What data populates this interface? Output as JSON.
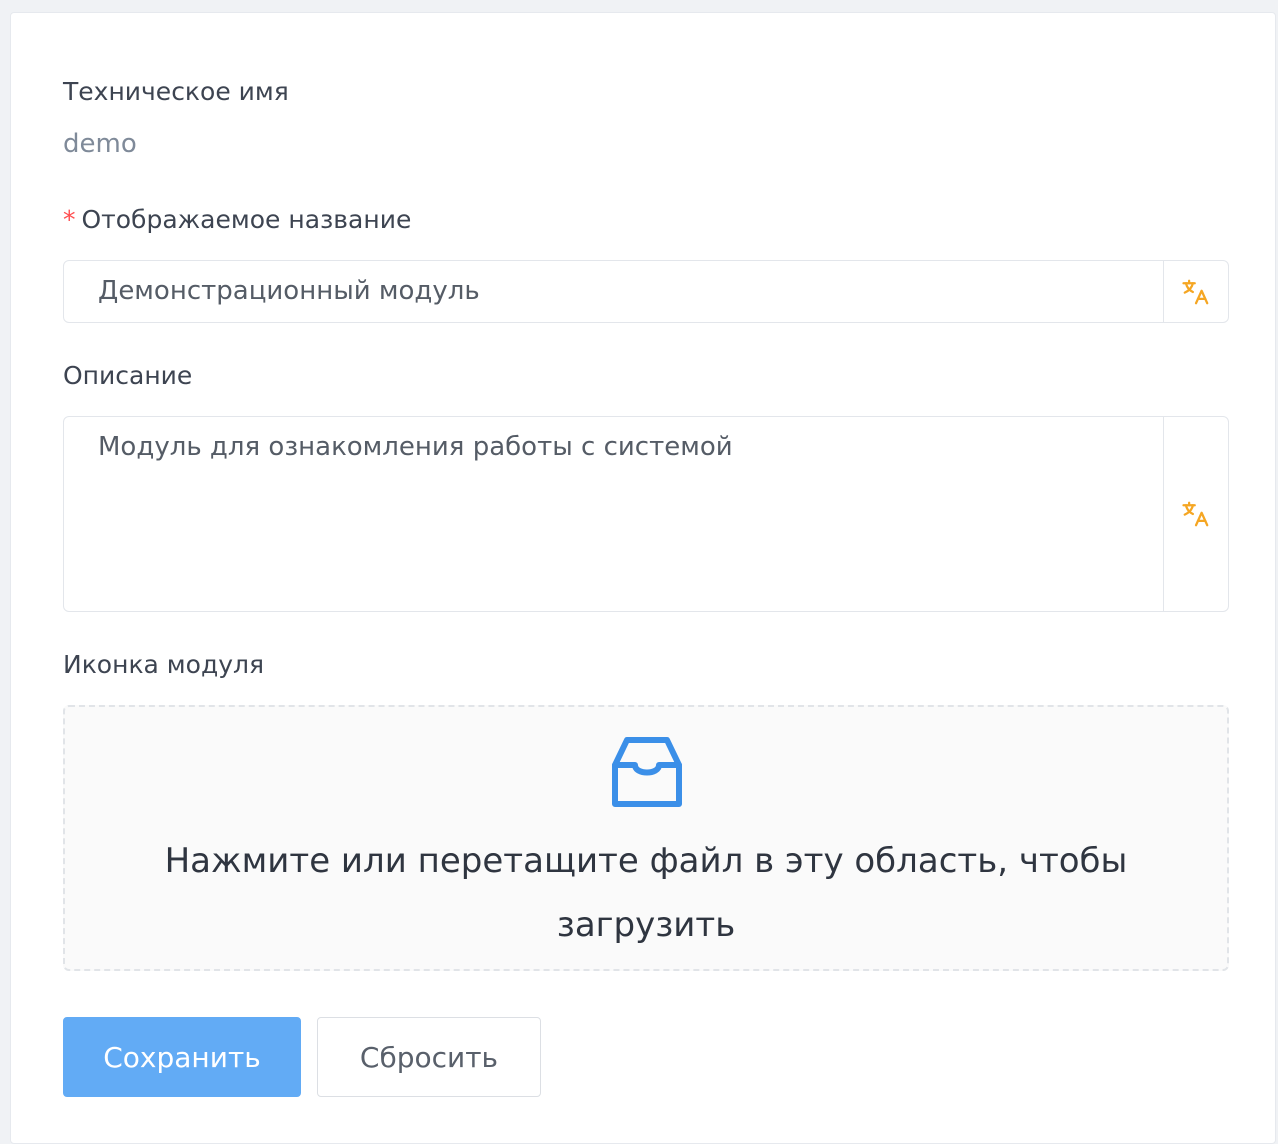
{
  "form": {
    "technical_name_label": "Техническое имя",
    "technical_name_value": "demo",
    "display_name_label": "Отображаемое название",
    "display_name_required_mark": "*",
    "display_name_value": "Демонстрационный модуль",
    "description_label": "Описание",
    "description_value": "Модуль для ознакомления работы с системой",
    "icon_label": "Иконка модуля",
    "dropzone_text": "Нажмите или перетащите файл в эту область, чтобы загрузить",
    "save_label": "Сохранить",
    "reset_label": "Сбросить"
  },
  "icons": {
    "translate": "translate-icon",
    "upload": "inbox-icon"
  },
  "colors": {
    "primary": "#62abf5",
    "required": "#ff4d4f",
    "translate_icon": "#f5a623",
    "upload_icon": "#3b8fe8"
  }
}
